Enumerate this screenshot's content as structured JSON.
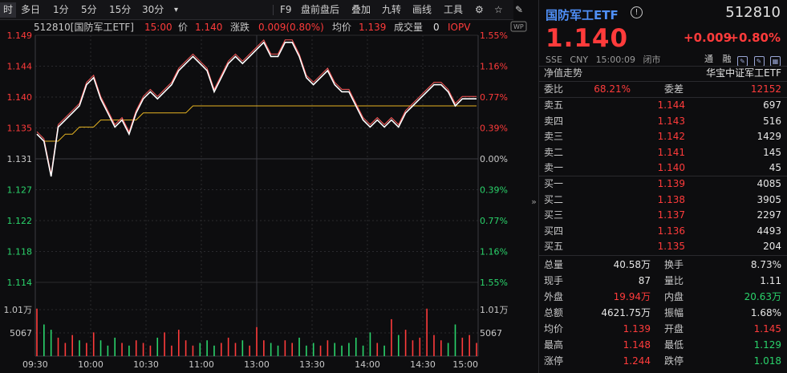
{
  "toolbar": {
    "items": [
      "时",
      "多日",
      "1分",
      "5分",
      "15分",
      "30分",
      "▾",
      "F9",
      "盘前盘后",
      "叠加",
      "九转",
      "画线",
      "工具",
      "⚙",
      "☆",
      "✎"
    ]
  },
  "chart": {
    "title": "512810[国防军工ETF]",
    "time": "15:00",
    "price_label": "价",
    "price": "1.140",
    "change_label": "涨跌",
    "change": "0.009(0.80%)",
    "avg_label": "均价",
    "avg": "1.139",
    "vol_label": "成交量",
    "vol": "0",
    "iopv_label": "IOPV",
    "wp_badge": "WP",
    "price_ticks": [
      "1.149",
      "1.144",
      "1.140",
      "1.135",
      "1.131",
      "1.127",
      "1.122",
      "1.118",
      "1.114"
    ],
    "pct_ticks": [
      "1.55%",
      "1.16%",
      "0.77%",
      "0.39%",
      "0.00%",
      "0.39%",
      "0.77%",
      "1.16%",
      "1.55%"
    ],
    "vol_ticks": [
      "1.01万",
      "5067"
    ],
    "time_ticks": [
      "09:30",
      "10:00",
      "10:30",
      "11:00",
      "13:00",
      "13:30",
      "14:00",
      "14:30",
      "15:00"
    ],
    "colors": {
      "up": "#ff3b3b",
      "down": "#2ad36b",
      "price_line": "#ffffff",
      "avg_line": "#e6b422",
      "iopv_line": "#ff5a5a",
      "grid": "#2a2a2e"
    }
  },
  "chart_data": {
    "type": "line",
    "ylim": [
      1.114,
      1.149
    ],
    "prev_close": 1.131,
    "price": [
      1.135,
      1.134,
      1.129,
      1.136,
      1.137,
      1.138,
      1.139,
      1.142,
      1.143,
      1.14,
      1.138,
      1.136,
      1.137,
      1.135,
      1.138,
      1.14,
      1.141,
      1.14,
      1.141,
      1.142,
      1.144,
      1.145,
      1.146,
      1.145,
      1.144,
      1.141,
      1.143,
      1.145,
      1.146,
      1.145,
      1.146,
      1.147,
      1.148,
      1.146,
      1.146,
      1.148,
      1.148,
      1.146,
      1.143,
      1.142,
      1.143,
      1.144,
      1.142,
      1.141,
      1.141,
      1.139,
      1.137,
      1.136,
      1.137,
      1.136,
      1.137,
      1.136,
      1.138,
      1.139,
      1.14,
      1.141,
      1.142,
      1.142,
      1.141,
      1.139,
      1.14,
      1.14,
      1.14
    ],
    "avg": [
      1.135,
      1.134,
      1.134,
      1.134,
      1.135,
      1.135,
      1.136,
      1.136,
      1.136,
      1.137,
      1.137,
      1.137,
      1.137,
      1.137,
      1.137,
      1.138,
      1.138,
      1.138,
      1.138,
      1.138,
      1.138,
      1.138,
      1.139,
      1.139,
      1.139,
      1.139,
      1.139,
      1.139,
      1.139,
      1.139,
      1.139,
      1.139,
      1.139,
      1.139,
      1.139,
      1.139,
      1.139,
      1.139,
      1.139,
      1.139,
      1.139,
      1.139,
      1.139,
      1.139,
      1.139,
      1.139,
      1.139,
      1.139,
      1.139,
      1.139,
      1.139,
      1.139,
      1.139,
      1.139,
      1.139,
      1.139,
      1.139,
      1.139,
      1.139,
      1.139,
      1.139,
      1.139,
      1.139
    ],
    "volume": [
      9000,
      6000,
      5000,
      3500,
      2500,
      4000,
      3000,
      2500,
      4500,
      3000,
      2000,
      3500,
      2500,
      2000,
      3000,
      2500,
      2000,
      3500,
      4500,
      2000,
      5000,
      3000,
      2000,
      2500,
      3000,
      2000,
      2500,
      3500,
      2500,
      3000,
      2000,
      5500,
      3000,
      2500,
      2000,
      3000,
      2500,
      3500,
      2000,
      2500,
      2000,
      3000,
      2500,
      2000,
      2500,
      3500,
      2000,
      4500,
      2500,
      2000,
      7000,
      4000,
      5000,
      3000,
      3500,
      9000,
      4000,
      3000,
      2500,
      6000,
      3500,
      4000,
      2500
    ],
    "volume_up": [
      true,
      false,
      false,
      true,
      true,
      true,
      false,
      true,
      true,
      false,
      false,
      false,
      true,
      false,
      true,
      true,
      true,
      false,
      true,
      true,
      true,
      true,
      true,
      false,
      false,
      false,
      true,
      true,
      true,
      false,
      true,
      true,
      true,
      false,
      false,
      true,
      true,
      false,
      false,
      false,
      true,
      true,
      false,
      false,
      false,
      false,
      false,
      false,
      true,
      false,
      true,
      false,
      true,
      true,
      true,
      true,
      true,
      true,
      false,
      false,
      true,
      true,
      true
    ]
  },
  "panel": {
    "name": "国防军工ETF",
    "info_icon": "!",
    "code": "512810",
    "price": "1.140",
    "change": "+0.009",
    "change_pct": "+0.80%",
    "exchange": "SSE",
    "currency": "CNY",
    "time": "15:00:09",
    "status": "闭市",
    "tag_tong": "通",
    "tag_rong": "融",
    "nav_label": "净值走势",
    "index_name": "华宝中证军工ETF",
    "weibi_label": "委比",
    "weibi": "68.21%",
    "weicha_label": "委差",
    "weicha": "12152",
    "asks": [
      {
        "label": "卖五",
        "price": "1.144",
        "vol": "697"
      },
      {
        "label": "卖四",
        "price": "1.143",
        "vol": "516"
      },
      {
        "label": "卖三",
        "price": "1.142",
        "vol": "1429"
      },
      {
        "label": "卖二",
        "price": "1.141",
        "vol": "145"
      },
      {
        "label": "卖一",
        "price": "1.140",
        "vol": "45"
      }
    ],
    "bids": [
      {
        "label": "买一",
        "price": "1.139",
        "vol": "4085"
      },
      {
        "label": "买二",
        "price": "1.138",
        "vol": "3905"
      },
      {
        "label": "买三",
        "price": "1.137",
        "vol": "2297"
      },
      {
        "label": "买四",
        "price": "1.136",
        "vol": "4493"
      },
      {
        "label": "买五",
        "price": "1.135",
        "vol": "204"
      }
    ],
    "stats": [
      {
        "l1": "总量",
        "v1": "40.58万",
        "c1": "white",
        "l2": "换手",
        "v2": "8.73%",
        "c2": "white"
      },
      {
        "l1": "现手",
        "v1": "87",
        "c1": "white",
        "l2": "量比",
        "v2": "1.11",
        "c2": "white"
      },
      {
        "l1": "外盘",
        "v1": "19.94万",
        "c1": "red",
        "l2": "内盘",
        "v2": "20.63万",
        "c2": "green"
      },
      {
        "l1": "总额",
        "v1": "4621.75万",
        "c1": "white",
        "l2": "振幅",
        "v2": "1.68%",
        "c2": "white"
      },
      {
        "l1": "均价",
        "v1": "1.139",
        "c1": "red",
        "l2": "开盘",
        "v2": "1.145",
        "c2": "red"
      },
      {
        "l1": "最高",
        "v1": "1.148",
        "c1": "red",
        "l2": "最低",
        "v2": "1.129",
        "c2": "green"
      },
      {
        "l1": "涨停",
        "v1": "1.244",
        "c1": "red",
        "l2": "跌停",
        "v2": "1.018",
        "c2": "green"
      }
    ]
  }
}
